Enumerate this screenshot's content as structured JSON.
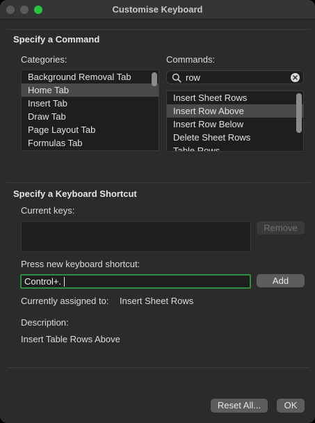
{
  "window": {
    "title": "Customise Keyboard"
  },
  "specify_command": {
    "title": "Specify a Command",
    "categories_label": "Categories:",
    "commands_label": "Commands:",
    "categories": [
      "Background Removal Tab",
      "Home Tab",
      "Insert Tab",
      "Draw Tab",
      "Page Layout Tab",
      "Formulas Tab"
    ],
    "selected_category": "Home Tab",
    "search_value": "row",
    "commands": [
      "Insert Sheet Rows",
      "Insert Row Above",
      "Insert Row Below",
      "Delete Sheet Rows",
      "Table Rows"
    ],
    "selected_command": "Insert Row Above"
  },
  "shortcut": {
    "title": "Specify a Keyboard Shortcut",
    "current_keys_label": "Current keys:",
    "remove_label": "Remove",
    "press_label": "Press new keyboard shortcut:",
    "input_value": "Control+.",
    "add_label": "Add",
    "assigned_label": "Currently assigned to:",
    "assigned_value": "Insert Sheet Rows",
    "description_label": "Description:",
    "description_value": "Insert Table Rows Above"
  },
  "footer": {
    "reset_label": "Reset All...",
    "ok_label": "OK"
  },
  "colors": {
    "accent_green": "#2f8a43",
    "window_bg": "#2b2b2b"
  }
}
